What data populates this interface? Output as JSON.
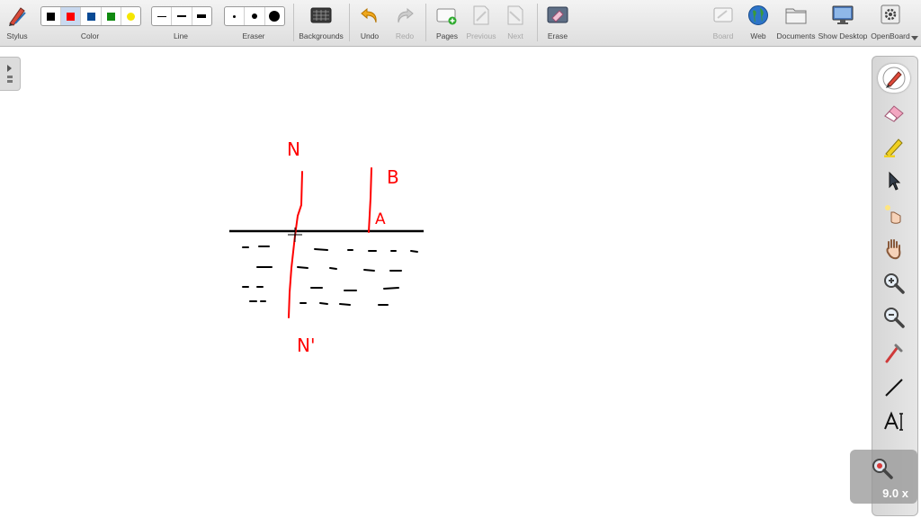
{
  "toolbar": {
    "stylus_label": "Stylus",
    "color_label": "Color",
    "line_label": "Line",
    "eraser_label": "Eraser",
    "backgrounds_label": "Backgrounds",
    "undo_label": "Undo",
    "redo_label": "Redo",
    "pages_label": "Pages",
    "previous_label": "Previous",
    "next_label": "Next",
    "erase_label": "Erase",
    "board_label": "Board",
    "web_label": "Web",
    "documents_label": "Documents",
    "show_desktop_label": "Show Desktop",
    "openboard_label": "OpenBoard",
    "colors": [
      "#000000",
      "#ff0000",
      "#0a4a94",
      "#118a11",
      "#f5e600"
    ],
    "selected_color": "#ff0000"
  },
  "drawing": {
    "label_n": "N",
    "label_b": "B",
    "label_a": "A",
    "label_n_prime": "N'"
  },
  "zoom": {
    "value": "9.0 x"
  },
  "palette": {
    "tools": [
      "pen-icon",
      "eraser-icon",
      "highlighter-icon",
      "pointer-icon",
      "laser-pointer-icon",
      "hand-icon",
      "zoom-in-icon",
      "zoom-out-icon",
      "capture-icon",
      "line-tool-icon",
      "text-tool-icon"
    ]
  }
}
